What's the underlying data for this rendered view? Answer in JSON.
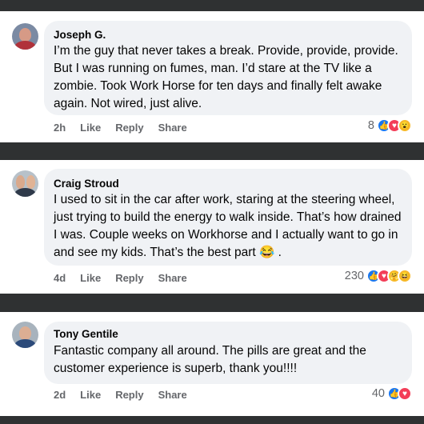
{
  "comments": [
    {
      "name": "Joseph G.",
      "text": "I’m the guy that never takes a break. Provide, provide, provide. But I was running on fumes, man. I’d stare at the TV like a zombie. Took Work Horse for ten days and finally felt awake again. Not wired, just alive.",
      "time": "2h",
      "like": "Like",
      "reply": "Reply",
      "share": "Share",
      "reaction_count": "8",
      "reactions": [
        "like-icon",
        "love-icon",
        "wow-icon"
      ]
    },
    {
      "name": "Craig Stroud",
      "text": "I used to sit in the car after work, staring at the steering wheel, just trying to build the energy to walk inside. That’s how drained I was. Couple weeks on Workhorse and I actually want to go in and see my kids. That’s the best part 😂 .",
      "time": "4d",
      "like": "Like",
      "reply": "Reply",
      "share": "Share",
      "reaction_count": "230",
      "reactions": [
        "like-icon",
        "love-icon",
        "care-icon",
        "haha-icon"
      ]
    },
    {
      "name": "Tony Gentile",
      "text": "Fantastic company all around. The pills are great and the customer experience is superb, thank you!!!!",
      "time": "2d",
      "like": "Like",
      "reply": "Reply",
      "share": "Share",
      "reaction_count": "40",
      "reactions": [
        "like-icon",
        "love-icon"
      ]
    }
  ]
}
